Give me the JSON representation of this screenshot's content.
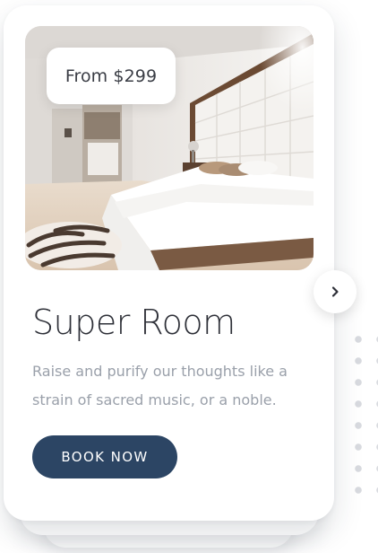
{
  "card": {
    "price_badge": "From $299",
    "title": "Super Room",
    "description": "Raise and purify our thoughts like a strain of sacred music, or a noble.",
    "book_button": "BOOK NOW",
    "image_subject": "bright hotel bedroom with white upholstered headboard, white bed and zebra-print rug"
  },
  "navigation": {
    "next_icon": "chevron-right-icon"
  },
  "colors": {
    "primary_button": "#2c4564",
    "title_text": "#2e3038",
    "body_text": "#9aa0aa",
    "card_background": "#ffffff",
    "dots": "#d8dadf"
  }
}
